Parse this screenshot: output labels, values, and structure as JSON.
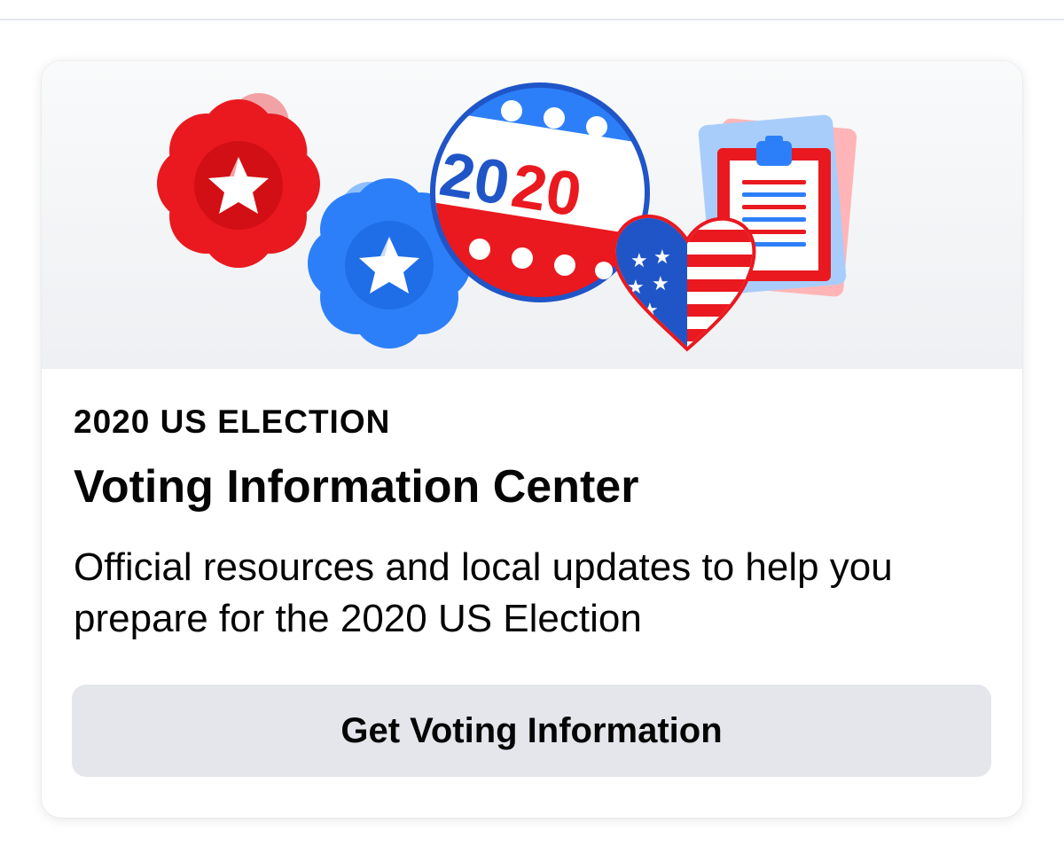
{
  "card": {
    "eyebrow": "2020 US ELECTION",
    "title": "Voting Information Center",
    "description": "Official resources and local updates to help you prepare for the 2020 US Election",
    "button_label": "Get Voting Information"
  },
  "illustration": {
    "button_text_blue": "20",
    "button_text_red": "20",
    "icons": [
      "red-star-badge-icon",
      "blue-star-badge-icon",
      "2020-campaign-button-icon",
      "clipboard-icon",
      "flag-heart-icon"
    ]
  },
  "colors": {
    "red": "#e9191f",
    "blue": "#2d7ff9",
    "dark_blue": "#2055c8",
    "button_bg": "#e4e6eb",
    "text": "#050505"
  }
}
